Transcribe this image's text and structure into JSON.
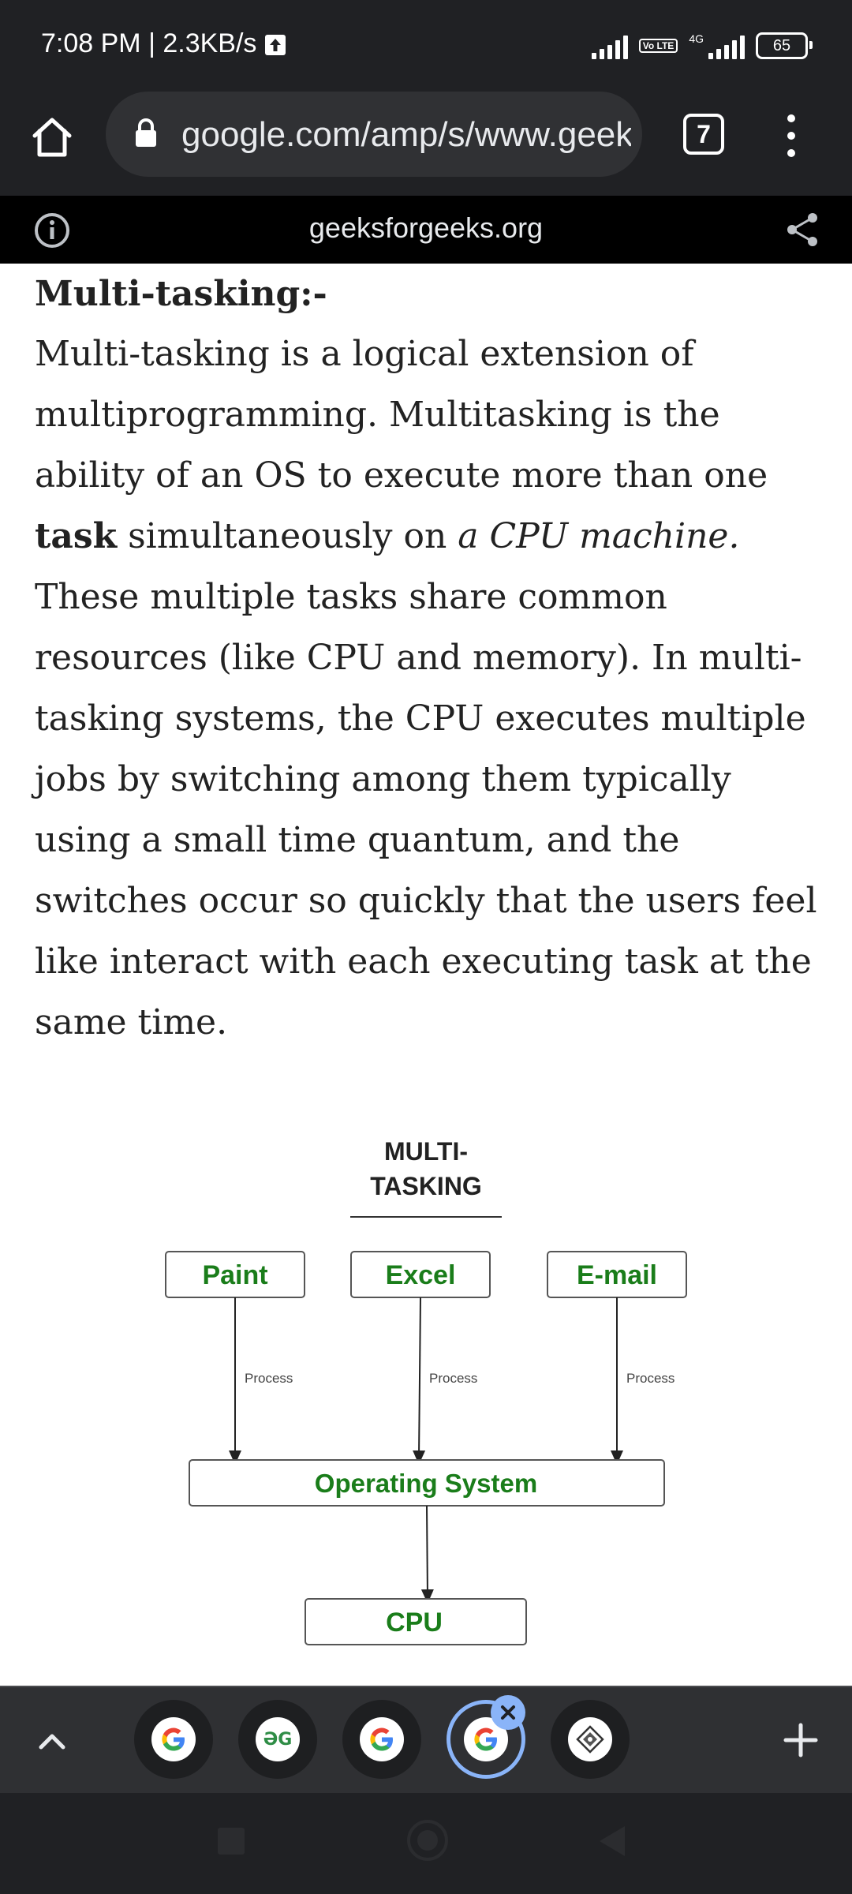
{
  "status_bar": {
    "time": "7:08 PM | 2.3KB/s",
    "volte": "Vo LTE",
    "network": "4G",
    "battery": "65"
  },
  "url_bar": {
    "url": "google.com/amp/s/www.geeksforgeeks.org",
    "tab_count": "7"
  },
  "info_strip": {
    "domain": "geeksforgeeks.org"
  },
  "article": {
    "heading": "Multi-tasking:-",
    "p_part1": "Multi-tasking is a logical extension of multiprogramming. Multitasking is the ability of an OS to execute more than one ",
    "p_bold": "task",
    "p_part2": " simultaneously on ",
    "p_italic": "a CPU machine.",
    "p_part3": " These multiple tasks share common resources (like CPU and memory). In multi-tasking systems, the CPU executes multiple jobs by switching among them typically using a small time quantum, and the switches occur so quickly that the users feel like interact with each executing task at the same time."
  },
  "diagram": {
    "title_line1": "MULTI-",
    "title_line2": "TASKING",
    "apps": [
      "Paint",
      "Excel",
      "E-mail"
    ],
    "edge_label": "Process",
    "os": "Operating System",
    "cpu": "CPU",
    "label_color": "#1a7d1a"
  },
  "tab_strip": {
    "tabs": [
      {
        "icon": "google-icon"
      },
      {
        "icon": "geeksforgeeks-icon",
        "label": "ƏG"
      },
      {
        "icon": "google-icon"
      },
      {
        "icon": "google-icon",
        "active": true
      },
      {
        "icon": "site-icon"
      }
    ]
  },
  "colors": {
    "chrome_dark": "#202124",
    "accent_blue": "#8ab4f8"
  }
}
